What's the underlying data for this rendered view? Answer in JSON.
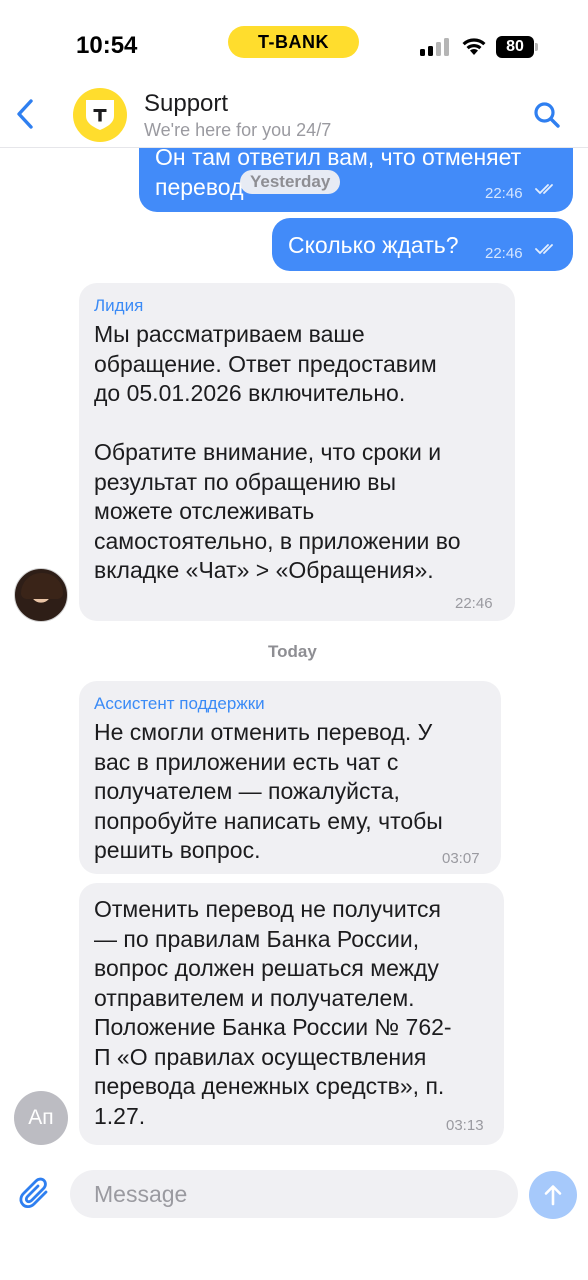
{
  "status_bar": {
    "time": "10:54",
    "brand": "T-BANK",
    "battery": "80",
    "icons": [
      "signal-icon",
      "wifi-icon",
      "battery-icon"
    ]
  },
  "header": {
    "title": "Support",
    "subtitle": "We're here for you 24/7",
    "logo_letter": "T",
    "icons": [
      "back-chevron-icon",
      "search-icon"
    ]
  },
  "chat": {
    "outgoing": [
      {
        "text": "Он там ответил вам, что отменяет\nперевод",
        "time": "22:46",
        "status": "read"
      },
      {
        "text": "Сколько ждать?",
        "time": "22:46",
        "status": "read"
      }
    ],
    "date_separator_yesterday": "Yesterday",
    "incoming_1": {
      "sender": "Лидия",
      "text": "Мы рассматриваем ваше\nобращение. Ответ предоставим\nдо 05.01.2026 включительно.\n\nОбратите внимание, что сроки и\nрезультат по обращению вы\nможете отслеживать\nсамостоятельно, в приложении во\nвкладке «Чат» > «Обращения».",
      "time": "22:46"
    },
    "date_separator_today": "Today",
    "incoming_2": {
      "sender": "Ассистент поддержки",
      "text": "Не смогли отменить перевод. У\nвас в приложении есть чат с\nполучателем — пожалуйста,\nпопробуйте написать ему, чтобы\nрешить вопрос.",
      "time": "03:07"
    },
    "incoming_3": {
      "text": "Отменить перевод не получится\n— по правилам Банка России,\nвопрос должен решаться между\nотправителем и получателем.\nПоложение Банка России № 762-\nП «О правилах осуществления\nперевода денежных средств», п.\n1.27.",
      "time": "03:13",
      "avatar_initials": "Ап"
    }
  },
  "input": {
    "placeholder": "Message",
    "icons": [
      "paperclip-icon",
      "send-arrow-icon"
    ]
  },
  "colors": {
    "brand_yellow": "#ffdd2d",
    "outgoing_bubble": "#428bf9",
    "incoming_bubble": "#f0f0f3",
    "accent_blue": "#3b8bf6",
    "send_button": "#a6c9fb"
  }
}
